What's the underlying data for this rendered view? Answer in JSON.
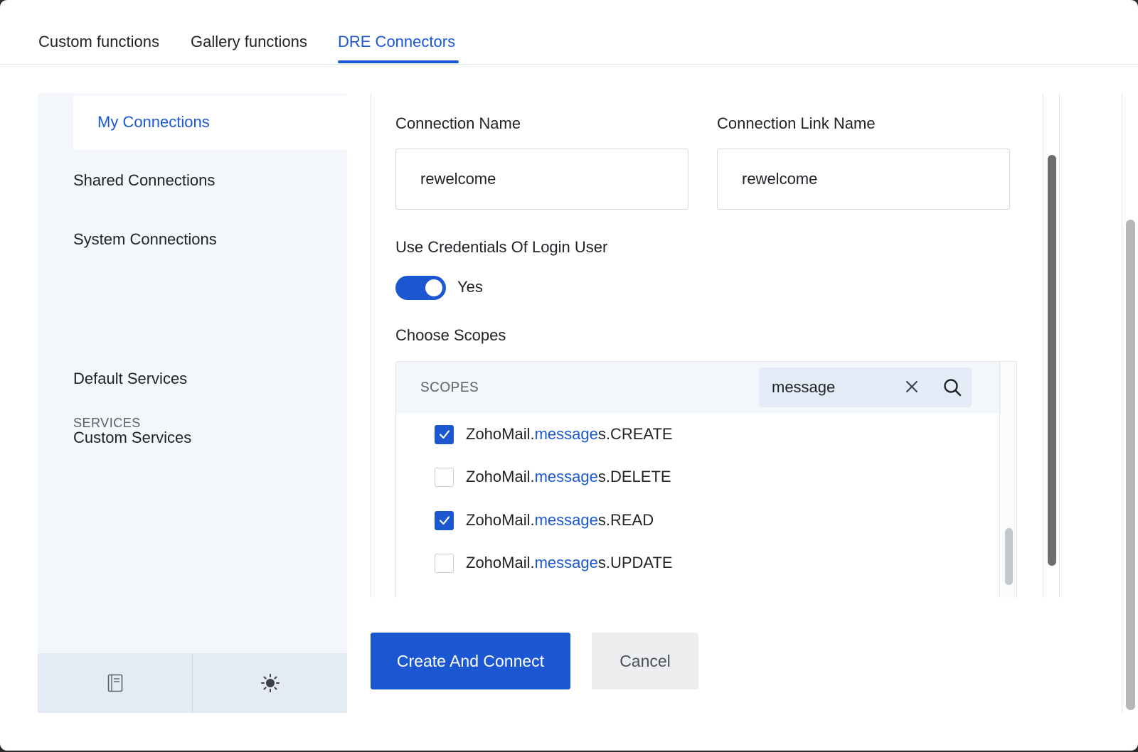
{
  "tabs": [
    {
      "label": "Custom functions",
      "active": false
    },
    {
      "label": "Gallery functions",
      "active": false
    },
    {
      "label": "DRE Connectors",
      "active": true
    }
  ],
  "sidebar": {
    "connections": [
      "My Connections",
      "Shared Connections",
      "System Connections"
    ],
    "services_heading": "SERVICES",
    "services": [
      "Default Services",
      "Custom Services"
    ],
    "bottom_icons": [
      "notebook-icon",
      "sun-icon"
    ]
  },
  "form": {
    "connection_name_label": "Connection Name",
    "connection_name_value": "rewelcome",
    "link_name_label": "Connection Link Name",
    "link_name_value": "rewelcome",
    "credentials_label": "Use Credentials Of Login User",
    "credentials_toggle": "Yes",
    "scopes_label": "Choose Scopes"
  },
  "scopes": {
    "header": "SCOPES",
    "search_value": "message",
    "items": [
      {
        "prefix": "ZohoMail.",
        "match": "message",
        "suffix": "s.CREATE",
        "checked": true
      },
      {
        "prefix": "ZohoMail.",
        "match": "message",
        "suffix": "s.DELETE",
        "checked": false
      },
      {
        "prefix": "ZohoMail.",
        "match": "message",
        "suffix": "s.READ",
        "checked": true
      },
      {
        "prefix": "ZohoMail.",
        "match": "message",
        "suffix": "s.UPDATE",
        "checked": false
      }
    ]
  },
  "buttons": {
    "primary": "Create And Connect",
    "secondary": "Cancel"
  },
  "colors": {
    "accent": "#1c57d2",
    "sidebar_bg": "#f3f6fb"
  }
}
